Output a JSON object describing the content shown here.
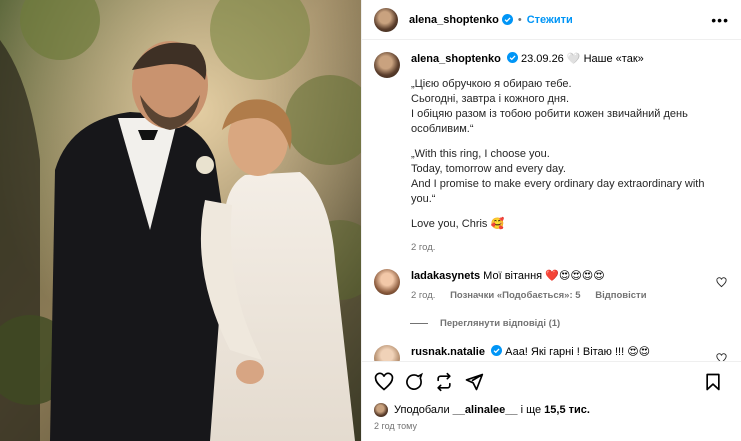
{
  "header": {
    "username": "alena_shoptenko",
    "separator": "•",
    "follow_label": "Стежити",
    "more_label": "•••"
  },
  "caption": {
    "username": "alena_shoptenko",
    "date_text": "23.09.26 🤍 Наше «так»",
    "ua_lines": [
      "„Цією обручкою я обираю тебе.",
      "Сьогодні, завтра і кожного дня.",
      "І обіцяю разом із тобою робити кожен звичайний день",
      "особливим.“"
    ],
    "en_lines": [
      "„With this ring, I choose you.",
      "Today, tomorrow and every day.",
      "And I promise to make every ordinary day extraordinary with",
      "you.“"
    ],
    "sign": "Love you, Chris 🥰",
    "time": "2 год."
  },
  "comments": [
    {
      "username": "ladakasynets",
      "text": "Мої вітання ❤️😍😍😍😍",
      "time": "2 год.",
      "likes": "Позначки «Подобається»: 5",
      "reply": "Відповісти",
      "view_replies": "Переглянути відповіді (1)"
    },
    {
      "username": "rusnak.natalie",
      "text": "Ааа! Які гарні ! Вітаю !!! 😍😍"
    }
  ],
  "footer": {
    "liked_prefix": "Уподобали",
    "liked_user": "__alinalee__",
    "liked_and": "і ще",
    "liked_count": "15,5 тис.",
    "time_ago": "2 год тому"
  },
  "colors": {
    "accent": "#0095f6",
    "muted": "#737373",
    "verified": "#0095f6"
  }
}
